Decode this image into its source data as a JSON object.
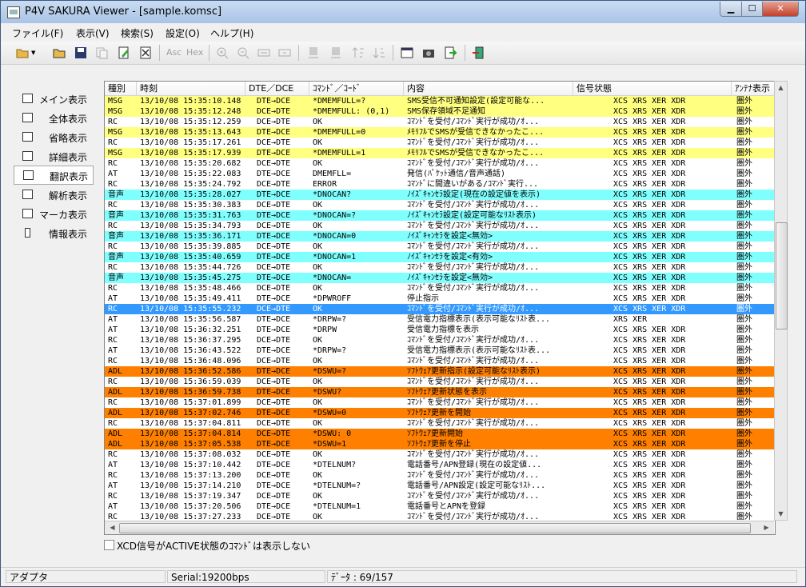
{
  "window": {
    "title": "P4V SAKURA Viewer - [sample.komsc]"
  },
  "menu": [
    "ファイル(F)",
    "表示(V)",
    "検索(S)",
    "設定(O)",
    "ヘルプ(H)"
  ],
  "toolbar": {
    "asc_label": "Asc",
    "hex_label": "Hex"
  },
  "sidebar": [
    {
      "label": "メイン表示",
      "icon": "window-icon"
    },
    {
      "label": "全体表示",
      "icon": "window-icon"
    },
    {
      "label": "省略表示",
      "icon": "list-icon"
    },
    {
      "label": "詳細表示",
      "icon": "detail-icon"
    },
    {
      "label": "翻訳表示",
      "icon": "translate-icon",
      "active": true
    },
    {
      "label": "解析表示",
      "icon": "analysis-icon"
    },
    {
      "label": "マーカ表示",
      "icon": "checkbox-icon"
    },
    {
      "label": "情報表示",
      "icon": "info-icon"
    }
  ],
  "table": {
    "headers": [
      "種別",
      "時刻",
      "DTE／DCE",
      "ｺﾏﾝﾄﾞ／ｺｰﾄﾞ",
      "内容",
      "信号状態",
      "ｱﾝﾃﾅ表示"
    ],
    "rows": [
      [
        "MSG",
        "13/10/08 15:35:10.148",
        "DTE→DCE",
        "*DMEMFULL=?",
        "SMS受信不可通知設定(設定可能な...",
        "XCS XRS XER XDR",
        "圏外",
        "msg"
      ],
      [
        "MSG",
        "13/10/08 15:35:12.248",
        "DCE→DTE",
        "*DMEMFULL: (0,1)",
        "SMS保存領域不足通知",
        "XCS XRS XER XDR",
        "圏外",
        "msg"
      ],
      [
        "RC",
        "13/10/08 15:35:12.259",
        "DCE→DTE",
        "OK",
        "ｺﾏﾝﾄﾞを受付/ｺﾏﾝﾄﾞ実行が成功/ｵ...",
        "XCS XRS XER XDR",
        "圏外",
        ""
      ],
      [
        "MSG",
        "13/10/08 15:35:13.643",
        "DTE→DCE",
        "*DMEMFULL=0",
        "ﾒﾓﾘﾌﾙでSMSが受信できなかったこ...",
        "XCS XRS XER XDR",
        "圏外",
        "msg"
      ],
      [
        "RC",
        "13/10/08 15:35:17.261",
        "DCE→DTE",
        "OK",
        "ｺﾏﾝﾄﾞを受付/ｺﾏﾝﾄﾞ実行が成功/ｵ...",
        "XCS XRS XER XDR",
        "圏外",
        ""
      ],
      [
        "MSG",
        "13/10/08 15:35:17.939",
        "DTE→DCE",
        "*DMEMFULL=1",
        "ﾒﾓﾘﾌﾙでSMSが受信できなかったこ...",
        "XCS XRS XER XDR",
        "圏外",
        "msg"
      ],
      [
        "RC",
        "13/10/08 15:35:20.682",
        "DCE→DTE",
        "OK",
        "ｺﾏﾝﾄﾞを受付/ｺﾏﾝﾄﾞ実行が成功/ｵ...",
        "XCS XRS XER XDR",
        "圏外",
        ""
      ],
      [
        "AT",
        "13/10/08 15:35:22.083",
        "DTE→DCE",
        "DMEMFLL=",
        "発信(ﾊﾟｹｯﾄ通信/音声通話)",
        "XCS XRS XER XDR",
        "圏外",
        ""
      ],
      [
        "RC",
        "13/10/08 15:35:24.792",
        "DCE→DTE",
        "ERROR",
        "ｺﾏﾝﾄﾞに間違いがある/ｺﾏﾝﾄﾞ実行...",
        "XCS XRS XER XDR",
        "圏外",
        ""
      ],
      [
        "音声",
        "13/10/08 15:35:28.027",
        "DTE→DCE",
        "*DNOCAN?",
        "ﾉｲｽﾞｷｬﾝｾﾗ設定(現在の設定値を表示)",
        "XCS XRS XER XDR",
        "圏外",
        "sound"
      ],
      [
        "RC",
        "13/10/08 15:35:30.383",
        "DCE→DTE",
        "OK",
        "ｺﾏﾝﾄﾞを受付/ｺﾏﾝﾄﾞ実行が成功/ｵ...",
        "XCS XRS XER XDR",
        "圏外",
        ""
      ],
      [
        "音声",
        "13/10/08 15:35:31.763",
        "DTE→DCE",
        "*DNOCAN=?",
        "ﾉｲｽﾞｷｬﾝｾﾗ設定(設定可能なﾘｽﾄ表示)",
        "XCS XRS XER XDR",
        "圏外",
        "sound"
      ],
      [
        "RC",
        "13/10/08 15:35:34.793",
        "DCE→DTE",
        "OK",
        "ｺﾏﾝﾄﾞを受付/ｺﾏﾝﾄﾞ実行が成功/ｵ...",
        "XCS XRS XER XDR",
        "圏外",
        ""
      ],
      [
        "音声",
        "13/10/08 15:35:36.171",
        "DTE→DCE",
        "*DNOCAN=0",
        "ﾉｲｽﾞｷｬﾝｾﾗを設定<無効>",
        "XCS XRS XER XDR",
        "圏外",
        "sound"
      ],
      [
        "RC",
        "13/10/08 15:35:39.885",
        "DCE→DTE",
        "OK",
        "ｺﾏﾝﾄﾞを受付/ｺﾏﾝﾄﾞ実行が成功/ｵ...",
        "XCS XRS XER XDR",
        "圏外",
        ""
      ],
      [
        "音声",
        "13/10/08 15:35:40.659",
        "DTE→DCE",
        "*DNOCAN=1",
        "ﾉｲｽﾞｷｬﾝｾﾗを設定<有効>",
        "XCS XRS XER XDR",
        "圏外",
        "sound"
      ],
      [
        "RC",
        "13/10/08 15:35:44.726",
        "DCE→DTE",
        "OK",
        "ｺﾏﾝﾄﾞを受付/ｺﾏﾝﾄﾞ実行が成功/ｵ...",
        "XCS XRS XER XDR",
        "圏外",
        ""
      ],
      [
        "音声",
        "13/10/08 15:35:45.275",
        "DTE→DCE",
        "*DNOCAN=",
        "ﾉｲｽﾞｷｬﾝｾﾗを設定<無効>",
        "XCS XRS XER XDR",
        "圏外",
        "sound"
      ],
      [
        "RC",
        "13/10/08 15:35:48.466",
        "DCE→DTE",
        "OK",
        "ｺﾏﾝﾄﾞを受付/ｺﾏﾝﾄﾞ実行が成功/ｵ...",
        "XCS XRS XER XDR",
        "圏外",
        ""
      ],
      [
        "AT",
        "13/10/08 15:35:49.411",
        "DTE→DCE",
        "*DPWROFF",
        "停止指示",
        "XCS XRS XER XDR",
        "圏外",
        ""
      ],
      [
        "RC",
        "13/10/08 15:35:55.232",
        "DCE→DTE",
        "OK",
        "ｺﾏﾝﾄﾞを受付/ｺﾏﾝﾄﾞ実行が成功/ｵ...",
        "XCS XRS XER XDR",
        "圏外",
        "sel"
      ],
      [
        "AT",
        "13/10/08 15:35:56.587",
        "DTE→DCE",
        "*DRPW=?",
        "受信電力指標表示(表示可能なﾘｽﾄ表...",
        "XRS XER",
        "圏外",
        ""
      ],
      [
        "AT",
        "13/10/08 15:36:32.251",
        "DTE→DCE",
        "*DRPW",
        "受信電力指標を表示",
        "XCS XRS XER XDR",
        "圏外",
        ""
      ],
      [
        "RC",
        "13/10/08 15:36:37.295",
        "DCE→DTE",
        "OK",
        "ｺﾏﾝﾄﾞを受付/ｺﾏﾝﾄﾞ実行が成功/ｵ...",
        "XCS XRS XER XDR",
        "圏外",
        ""
      ],
      [
        "AT",
        "13/10/08 15:36:43.522",
        "DTE→DCE",
        "*DRPW=?",
        "受信電力指標表示(表示可能なﾘｽﾄ表...",
        "XCS XRS XER XDR",
        "圏外",
        ""
      ],
      [
        "RC",
        "13/10/08 15:36:48.096",
        "DCE→DTE",
        "OK",
        "ｺﾏﾝﾄﾞを受付/ｺﾏﾝﾄﾞ実行が成功/ｵ...",
        "XCS XRS XER XDR",
        "圏外",
        ""
      ],
      [
        "ADL",
        "13/10/08 15:36:52.586",
        "DTE→DCE",
        "*DSWU=?",
        "ｿﾌﾄｳｪｱ更新指示(設定可能なﾘｽﾄ表示)",
        "XCS XRS XER XDR",
        "圏外",
        "adl"
      ],
      [
        "RC",
        "13/10/08 15:36:59.039",
        "DCE→DTE",
        "OK",
        "ｺﾏﾝﾄﾞを受付/ｺﾏﾝﾄﾞ実行が成功/ｵ...",
        "XCS XRS XER XDR",
        "圏外",
        ""
      ],
      [
        "ADL",
        "13/10/08 15:36:59.738",
        "DTE→DCE",
        "*DSWU?",
        "ｿﾌﾄｳｪｱ更新状態を表示",
        "XCS XRS XER XDR",
        "圏外",
        "adl"
      ],
      [
        "RC",
        "13/10/08 15:37:01.899",
        "DCE→DTE",
        "OK",
        "ｺﾏﾝﾄﾞを受付/ｺﾏﾝﾄﾞ実行が成功/ｵ...",
        "XCS XRS XER XDR",
        "圏外",
        ""
      ],
      [
        "ADL",
        "13/10/08 15:37:02.746",
        "DTE→DCE",
        "*DSWU=0",
        "ｿﾌﾄｳｪｱ更新を開始",
        "XCS XRS XER XDR",
        "圏外",
        "adl"
      ],
      [
        "RC",
        "13/10/08 15:37:04.811",
        "DCE→DTE",
        "OK",
        "ｺﾏﾝﾄﾞを受付/ｺﾏﾝﾄﾞ実行が成功/ｵ...",
        "XCS XRS XER XDR",
        "圏外",
        ""
      ],
      [
        "ADL",
        "13/10/08 15:37:04.814",
        "DCE→DTE",
        "*DSWU: 0",
        "ｿﾌﾄｳｪｱ更新開始",
        "XCS XRS XER XDR",
        "圏外",
        "adl"
      ],
      [
        "ADL",
        "13/10/08 15:37:05.538",
        "DTE→DCE",
        "*DSWU=1",
        "ｿﾌﾄｳｪｱ更新を停止",
        "XCS XRS XER XDR",
        "圏外",
        "adl"
      ],
      [
        "RC",
        "13/10/08 15:37:08.032",
        "DCE→DTE",
        "OK",
        "ｺﾏﾝﾄﾞを受付/ｺﾏﾝﾄﾞ実行が成功/ｵ...",
        "XCS XRS XER XDR",
        "圏外",
        ""
      ],
      [
        "AT",
        "13/10/08 15:37:10.442",
        "DTE→DCE",
        "*DTELNUM?",
        "電話番号/APN登録(現在の設定値...",
        "XCS XRS XER XDR",
        "圏外",
        ""
      ],
      [
        "RC",
        "13/10/08 15:37:13.200",
        "DCE→DTE",
        "OK",
        "ｺﾏﾝﾄﾞを受付/ｺﾏﾝﾄﾞ実行が成功/ｵ...",
        "XCS XRS XER XDR",
        "圏外",
        ""
      ],
      [
        "AT",
        "13/10/08 15:37:14.210",
        "DTE→DCE",
        "*DTELNUM=?",
        "電話番号/APN設定(設定可能なﾘｽﾄ...",
        "XCS XRS XER XDR",
        "圏外",
        ""
      ],
      [
        "RC",
        "13/10/08 15:37:19.347",
        "DCE→DTE",
        "OK",
        "ｺﾏﾝﾄﾞを受付/ｺﾏﾝﾄﾞ実行が成功/ｵ...",
        "XCS XRS XER XDR",
        "圏外",
        ""
      ],
      [
        "AT",
        "13/10/08 15:37:20.506",
        "DTE→DCE",
        "*DTELNUM=1",
        "電話番号とAPNを登録",
        "XCS XRS XER XDR",
        "圏外",
        ""
      ],
      [
        "RC",
        "13/10/08 15:37:27.233",
        "DCE→DTE",
        "OK",
        "ｺﾏﾝﾄﾞを受付/ｺﾏﾝﾄﾞ実行が成功/ｵ...",
        "XCS XRS XER XDR",
        "圏外",
        ""
      ]
    ]
  },
  "filter_checkbox": {
    "label": "XCD信号がACTIVE状態のｺﾏﾝﾄﾞは表示しない",
    "checked": false
  },
  "status": {
    "port": "アダプタ",
    "serial": "Serial:19200bps",
    "data": "ﾃﾞｰﾀ : 69/157"
  }
}
